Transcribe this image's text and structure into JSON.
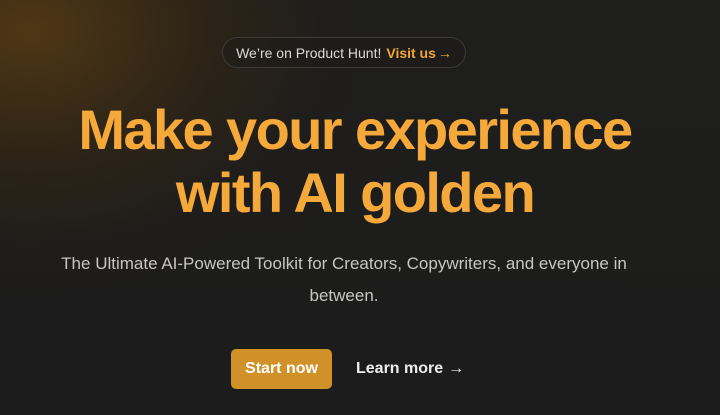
{
  "badge": {
    "text": "We’re on Product Hunt!",
    "link_label": "Visit us",
    "arrow": "→"
  },
  "hero": {
    "headline_line1": "Make your experience",
    "headline_line2": "with AI golden",
    "subtitle": "The Ultimate AI-Powered Toolkit for Creators, Copywriters, and everyone in between."
  },
  "actions": {
    "primary_label": "Start now",
    "secondary_label": "Learn more",
    "secondary_arrow": "→"
  },
  "colors": {
    "accent": "#f6a93b",
    "button": "#d19129",
    "background": "#1c1c1c"
  }
}
